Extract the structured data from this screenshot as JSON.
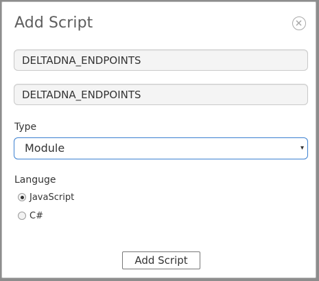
{
  "dialog": {
    "title": "Add Script",
    "close_icon": "close-circle-icon"
  },
  "fields": {
    "name_value": "DELTADNA_ENDPOINTS",
    "shortname_value": "DELTADNA_ENDPOINTS"
  },
  "type": {
    "label": "Type",
    "selected": "Module",
    "arrow": "▾"
  },
  "language": {
    "label": "Languge",
    "options": [
      {
        "label": "JavaScript",
        "checked": true
      },
      {
        "label": "C#",
        "checked": false
      }
    ]
  },
  "actions": {
    "submit_label": "Add Script"
  },
  "colors": {
    "select_border": "#3a7fd0",
    "field_bg": "#f4f4f4",
    "backdrop": "#8d8d8d"
  }
}
